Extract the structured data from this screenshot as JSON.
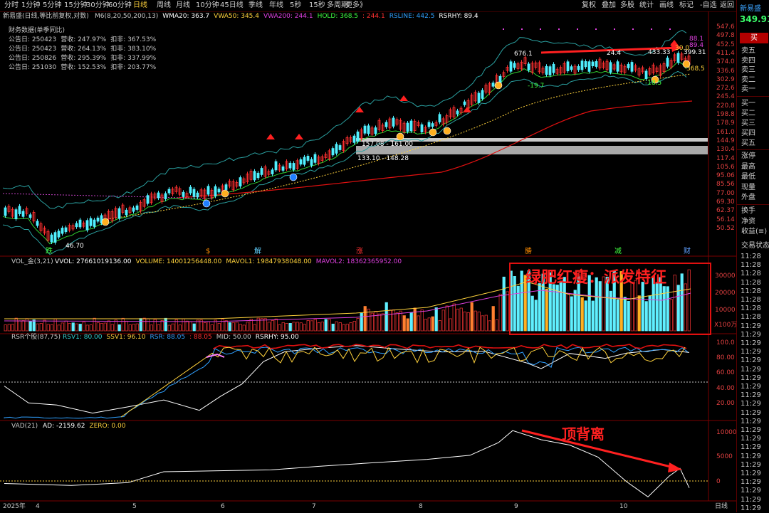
{
  "toolbar": {
    "periods": [
      "分时",
      "1分钟",
      "5分钟",
      "15分钟",
      "30分钟",
      "60分钟",
      "日线",
      "周线",
      "月线",
      "10分钟",
      "45日线",
      "季线",
      "年线",
      "5秒",
      "15秒",
      "多周期",
      "更多》"
    ],
    "right_items": [
      "复权",
      "叠加",
      "多股",
      "统计",
      "画线",
      "标记",
      "-自选",
      "返回"
    ]
  },
  "main": {
    "title": "新易盛(日线,等比前复权,对数)",
    "indicators": [
      {
        "text": "M6(8,20,50,200,13)",
        "color": "#c8c8c8"
      },
      {
        "text": "WMA20: 363.7",
        "color": "#ffffff"
      },
      {
        "text": "VWA50: 345.4",
        "color": "#ffd23c"
      },
      {
        "text": "VWA200: 244.1",
        "color": "#e040e0"
      },
      {
        "text": "HOLD: 368.5",
        "color": "#40ff40"
      },
      {
        "text": ": 244.1",
        "color": "#ff3030"
      },
      {
        "text": "RSLINE: 442.5",
        "color": "#30a0ff"
      },
      {
        "text": "RSRHY: 89.4",
        "color": "#ffffff"
      }
    ],
    "finance": {
      "header": "财务数据(单季同比)",
      "rows": [
        [
          "公告日: 250423",
          "营收:  247.97%",
          "扣非:  367.53%"
        ],
        [
          "公告日: 250423",
          "营收:  264.13%",
          "扣非:  383.10%"
        ],
        [
          "公告日: 250826",
          "营收:  295.39%",
          "扣非:  337.99%"
        ],
        [
          "公告日: 251030",
          "营收:  152.53%",
          "扣非:  203.77%"
        ]
      ]
    },
    "labels": {
      "low_price": "46.70",
      "zone1": "157.08 - 161.00",
      "zone2": "133.10 - 148.28",
      "peak1": "676.1",
      "dn1": "-19.7",
      "up2": "24.4",
      "peak2": "433.33",
      "dn2": "-18.5",
      "last": "399.31",
      "top1": "88.1",
      "top2": "89.4",
      "hold": "368.5",
      "small": "30.0"
    },
    "axis": [
      "547.6",
      "497.8",
      "452.5",
      "411.4",
      "374.0",
      "336.6",
      "302.9",
      "272.6",
      "245.4",
      "220.8",
      "198.8",
      "178.9",
      "161.0",
      "144.9",
      "130.4",
      "117.4",
      "105.6",
      "95.06",
      "85.56",
      "77.00",
      "69.30",
      "62.37",
      "56.14",
      "50.52"
    ],
    "event_markers": [
      {
        "text": "跌",
        "color": "#40ff40"
      },
      {
        "text": "$",
        "color": "#ff8c00"
      },
      {
        "text": "解",
        "color": "#60d0ff"
      },
      {
        "text": "涨",
        "color": "#ff3030"
      },
      {
        "text": "勝",
        "color": "#ff8c00"
      },
      {
        "text": "减",
        "color": "#40ff40"
      },
      {
        "text": "财",
        "color": "#60a0ff"
      }
    ]
  },
  "volume": {
    "title": "VOL_金(3,21)",
    "indicators": [
      {
        "text": "VVOL: 27661019136.00",
        "color": "#ffffff"
      },
      {
        "text": "VOLUME: 14001256448.00",
        "color": "#ffd23c"
      },
      {
        "text": "MAVOL1: 19847938048.00",
        "color": "#ffd23c"
      },
      {
        "text": "MAVOL2: 18362365952.00",
        "color": "#e040e0"
      }
    ],
    "axis": [
      "30000",
      "20000",
      "10000",
      "X100万"
    ],
    "annotation": "绿肥红瘦：派发特征"
  },
  "rsr": {
    "title": "RSR个股(87,75)",
    "indicators": [
      {
        "text": "RSV1: 80.00",
        "color": "#30d0d0"
      },
      {
        "text": "SSV1: 96.10",
        "color": "#ffd23c"
      },
      {
        "text": "RSR: 88.05",
        "color": "#30a0ff"
      },
      {
        "text": ": 88.05",
        "color": "#ff3030"
      },
      {
        "text": "MID: 50.00",
        "color": "#c8c8c8"
      },
      {
        "text": "RSRHY: 95.00",
        "color": "#ffffff"
      }
    ],
    "axis": [
      "100.0",
      "80.00",
      "60.00",
      "40.00",
      "20.00"
    ]
  },
  "vad": {
    "title": "VAD(21)",
    "indicators": [
      {
        "text": "AD: -2159.62",
        "color": "#ffffff"
      },
      {
        "text": "ZERO: 0.00",
        "color": "#ffd23c"
      }
    ],
    "axis": [
      "10000",
      "5000",
      "0"
    ],
    "annotation": "顶背离"
  },
  "xaxis": {
    "labels": [
      "2025年",
      "4",
      "5",
      "6",
      "7",
      "8",
      "9",
      "10"
    ],
    "right": "日线"
  },
  "sidebar": {
    "name": "新易盛",
    "price": "349.91",
    "buy": "买",
    "sell": [
      "卖五",
      "卖四",
      "卖三",
      "卖二",
      "卖一"
    ],
    "buys": [
      "买一",
      "买二",
      "买三",
      "买四",
      "买五"
    ],
    "stats": [
      "涨停",
      "最高",
      "最低",
      "现量",
      "外盘"
    ],
    "more": [
      "换手",
      "净资",
      "收益(≡)"
    ],
    "trade_title": "交易状态",
    "times": [
      "11:28",
      "11:28",
      "11:28",
      "11:28",
      "11:28",
      "11:28",
      "11:28",
      "11:28",
      "11:29",
      "11:29",
      "11:29",
      "11:29",
      "11:29",
      "11:29",
      "11:29",
      "11:29",
      "11:29",
      "11:29",
      "11:29",
      "11:29",
      "11:29",
      "11:29",
      "11:29",
      "11:29",
      "11:29",
      "11:29",
      "11:29",
      "11:29",
      "11:29",
      "11:29"
    ]
  }
}
